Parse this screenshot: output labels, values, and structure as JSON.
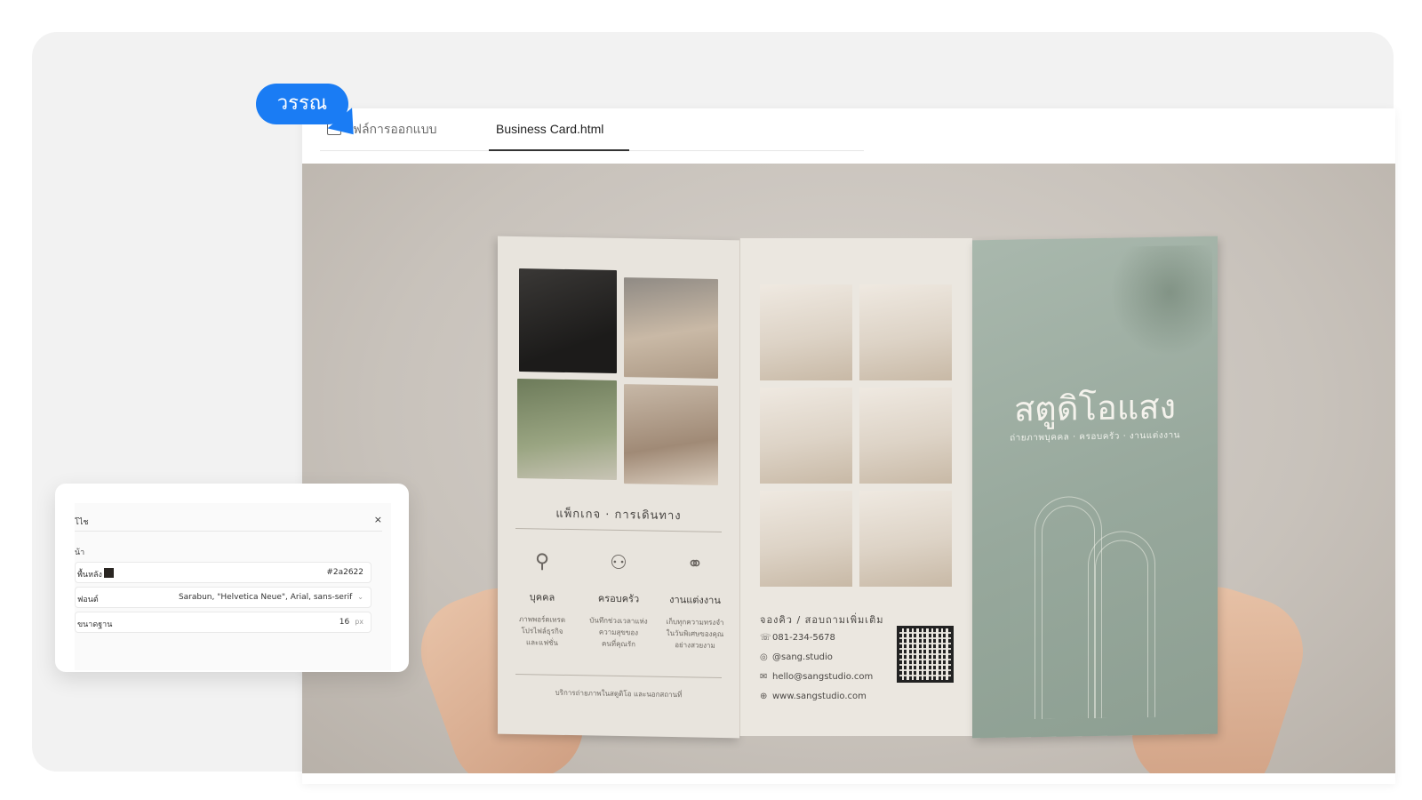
{
  "bubble": {
    "label": "วรรณ"
  },
  "tabs": [
    {
      "label": "ไฟล์การออกแบบ"
    },
    {
      "label": "Business Card.html",
      "active": true
    }
  ],
  "brochure": {
    "package_title": "แพ็กเกจ · การเดินทาง",
    "packages": [
      {
        "icon": "person-icon",
        "name": "บุคคล",
        "desc": [
          "ภาพพอร์ตเทรต",
          "โปรไฟล์ธุรกิจ",
          "และแฟชั่น"
        ]
      },
      {
        "icon": "family-icon",
        "name": "ครอบครัว",
        "desc": [
          "บันทึกช่วงเวลาแห่ง",
          "ความสุขของ",
          "คนที่คุณรัก"
        ]
      },
      {
        "icon": "rings-icon",
        "name": "งานแต่งงาน",
        "desc": [
          "เก็บทุกความทรงจำ",
          "ในวันพิเศษของคุณ",
          "อย่างสวยงาม"
        ]
      }
    ],
    "footnote": "บริการถ่ายภาพในสตูดิโอ และนอกสถานที่",
    "contact_title": "จองคิว / สอบถามเพิ่มเติม",
    "contacts": [
      {
        "icon": "phone-icon",
        "glyph": "☏",
        "text": "081-234-5678"
      },
      {
        "icon": "instagram-icon",
        "glyph": "◎",
        "text": "@sang.studio"
      },
      {
        "icon": "mail-icon",
        "glyph": "✉",
        "text": "hello@sangstudio.com"
      },
      {
        "icon": "globe-icon",
        "glyph": "⊕",
        "text": "www.sangstudio.com"
      }
    ],
    "studio_name": "สตูดิโอแสง",
    "studio_tagline": "ถ่ายภาพบุคคล · ครอบครัว · งานแต่งงาน"
  },
  "inspector": {
    "title": "โไช",
    "close": "×",
    "section": "น้า",
    "rows": [
      {
        "label": "พื้นหลัง",
        "value": "#2a2622"
      },
      {
        "label": "ฟอนต์",
        "value": "Sarabun, \"Helvetica Neue\", Arial, sans-serif"
      },
      {
        "label": "ขนาดฐาน",
        "value": "16",
        "unit": "px"
      }
    ],
    "colors": {
      "background": "#2a2622"
    }
  },
  "colors": {
    "accent": "#1a7cf4",
    "cover": "#97a89c"
  }
}
